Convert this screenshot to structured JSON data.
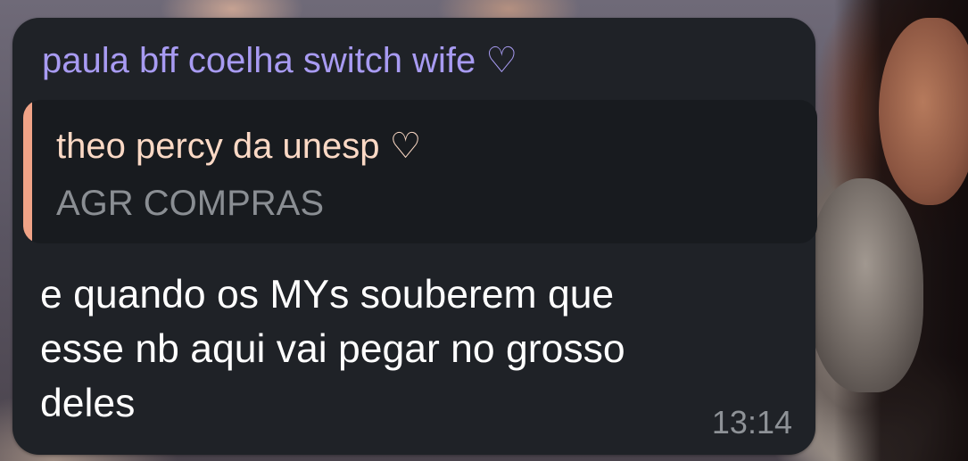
{
  "message": {
    "sender_name": "paula bff coelha switch wife ♡",
    "sender_color": "#a89bf2",
    "reply": {
      "author": "theo percy da unesp ♡",
      "author_color": "#fbd9c5",
      "text": "AGR COMPRAS",
      "accent_bar_color": "#f0a387"
    },
    "text": "e quando os MYs souberem que\nesse nb aqui vai pegar no grosso\ndeles",
    "time": "13:14",
    "bubble_color": "#1f2227"
  }
}
